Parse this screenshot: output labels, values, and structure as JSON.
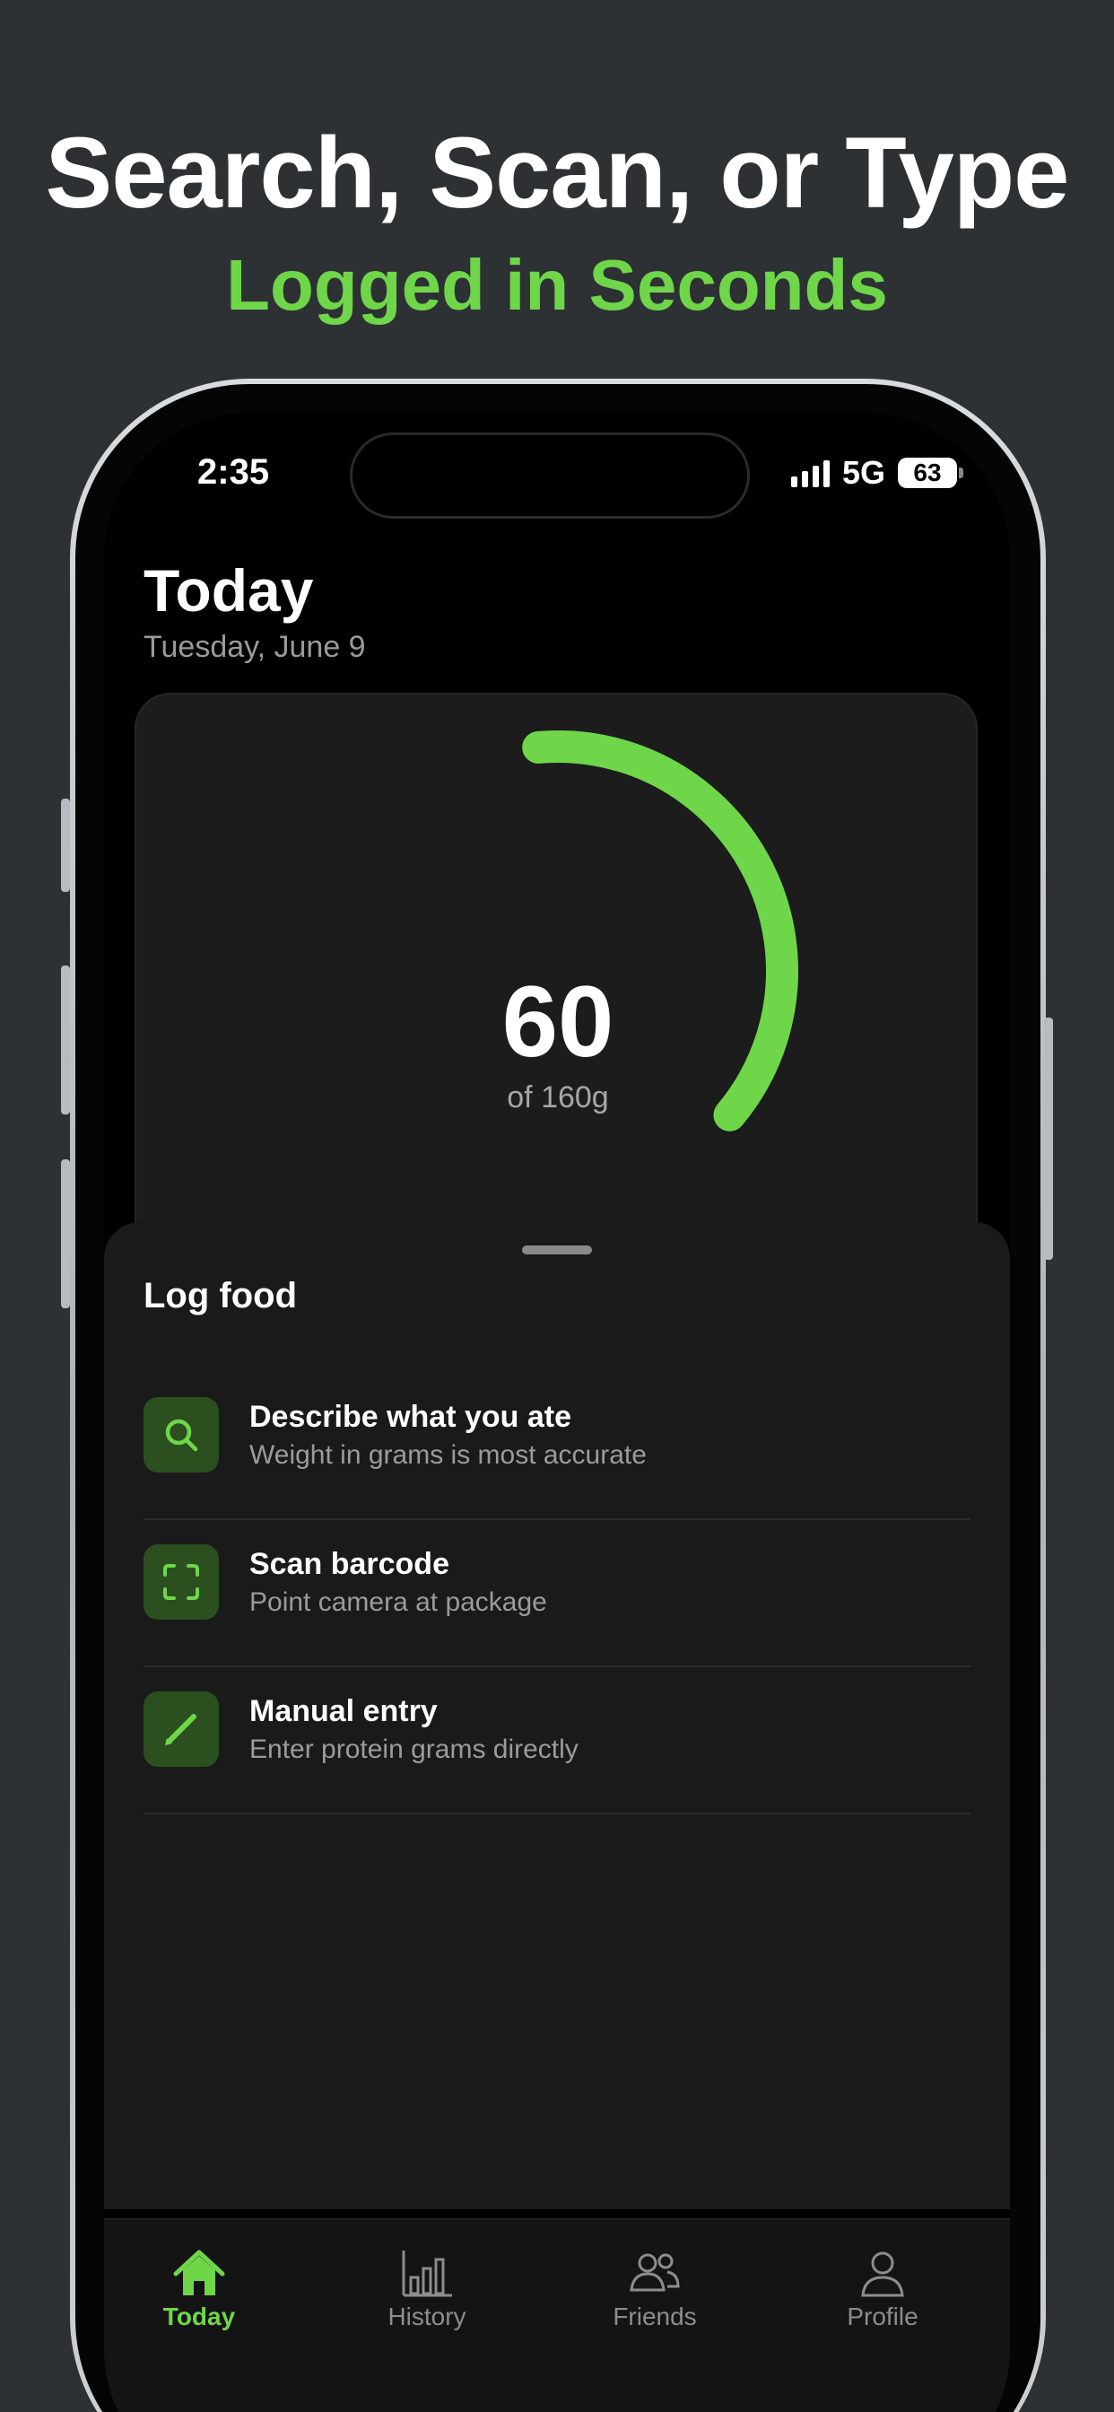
{
  "promo": {
    "headline": "Search, Scan, or Type",
    "subheadline": "Logged in Seconds"
  },
  "status_bar": {
    "time": "2:35",
    "network": "5G",
    "battery": "63"
  },
  "header": {
    "title": "Today",
    "date": "Tuesday, June 9"
  },
  "progress": {
    "value": "60",
    "goal_label": "of 160g",
    "current": 60,
    "goal": 160,
    "ring_color": "#6fd64a"
  },
  "log_food": {
    "title": "Log food",
    "options": [
      {
        "icon": "search-icon",
        "title": "Describe what you ate",
        "subtitle": "Weight in grams is most accurate"
      },
      {
        "icon": "barcode-scan-icon",
        "title": "Scan barcode",
        "subtitle": "Point camera at package"
      },
      {
        "icon": "pencil-icon",
        "title": "Manual entry",
        "subtitle": "Enter protein grams directly"
      }
    ]
  },
  "tabs": [
    {
      "icon": "home-icon",
      "label": "Today",
      "active": true
    },
    {
      "icon": "bar-chart-icon",
      "label": "History",
      "active": false
    },
    {
      "icon": "friends-icon",
      "label": "Friends",
      "active": false
    },
    {
      "icon": "profile-icon",
      "label": "Profile",
      "active": false
    }
  ],
  "colors": {
    "accent": "#6fd64a",
    "background": "#2e3134",
    "icon_tile": "#2b4f1f"
  }
}
